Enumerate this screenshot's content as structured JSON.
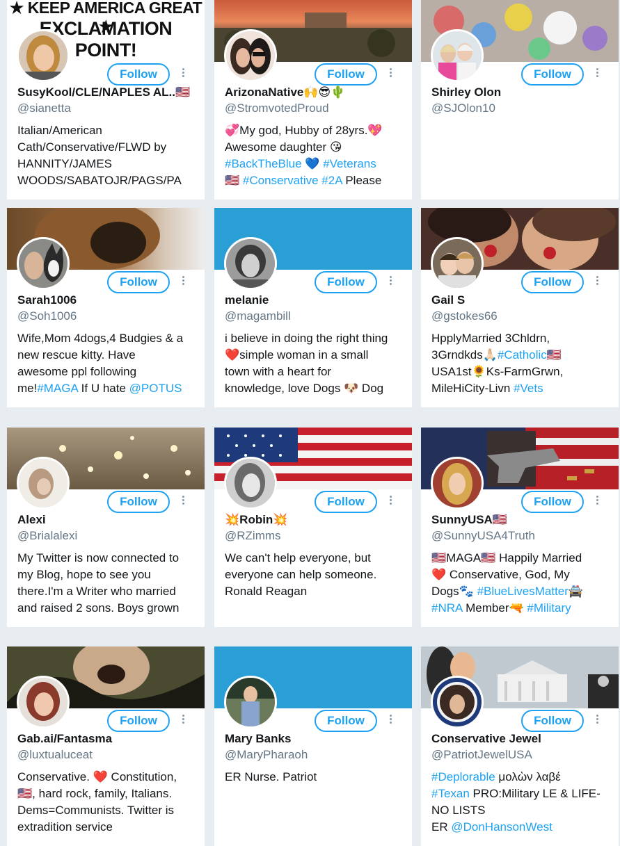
{
  "follow_label": "Follow",
  "cards": [
    {
      "name": "SusyKool/CLE/NAPLES AL..🇺🇸",
      "handle": "@sianetta",
      "banner_text_1": "★ KEEP AMERICA GREAT ★",
      "banner_text_2": "EXCLAMATION POINT!",
      "bio": [
        "Italian/American",
        "Cath/Conservative/FLWD by",
        "HANNITY/JAMES",
        "WOODS/SABATOJR/PAGS/PA"
      ]
    },
    {
      "name": "ArizonaNative🙌😎🌵",
      "handle": "@StromvotedProud",
      "bio_parts": [
        [
          {
            "t": "💞My god, Hubby of 28yrs.💖"
          }
        ],
        [
          {
            "t": "Awesome daughter 😘"
          }
        ],
        [
          {
            "t": "#BackTheBlue",
            "tag": true
          },
          {
            "t": " 💙 "
          },
          {
            "t": "#Veterans",
            "tag": true
          }
        ],
        [
          {
            "t": "🇺🇸 "
          },
          {
            "t": "#Conservative",
            "tag": true
          },
          {
            "t": " "
          },
          {
            "t": "#2A",
            "tag": true
          },
          {
            "t": " Please"
          }
        ]
      ]
    },
    {
      "name": "Shirley Olon",
      "handle": "@SJOlon10",
      "bio": []
    },
    {
      "name": "Sarah1006",
      "handle": "@Soh1006",
      "bio_parts": [
        [
          {
            "t": "Wife,Mom 4dogs,4 Budgies & a"
          }
        ],
        [
          {
            "t": "new rescue kitty. Have"
          }
        ],
        [
          {
            "t": "awesome ppl following"
          }
        ],
        [
          {
            "t": "me!"
          },
          {
            "t": "#MAGA",
            "tag": true
          },
          {
            "t": " If U hate "
          },
          {
            "t": "@POTUS",
            "tag": true
          }
        ]
      ]
    },
    {
      "name": "melanie",
      "handle": "@magambill",
      "bio_parts": [
        [
          {
            "t": "i believe in doing the right thing"
          }
        ],
        [
          {
            "t": "❤️simple woman in a small"
          }
        ],
        [
          {
            "t": "town with a heart for"
          }
        ],
        [
          {
            "t": "knowledge, love Dogs 🐶 Dog"
          }
        ]
      ]
    },
    {
      "name": "Gail S",
      "handle": "@gstokes66",
      "bio_parts": [
        [
          {
            "t": "HpplyMarried 3Chldrn,"
          }
        ],
        [
          {
            "t": "3Grndkds🙏🏻"
          },
          {
            "t": "#Catholic",
            "tag": true
          },
          {
            "t": "🇺🇸"
          }
        ],
        [
          {
            "t": "USA1st🌻Ks-FarmGrwn,"
          }
        ],
        [
          {
            "t": "MileHiCity-Livn "
          },
          {
            "t": "#Vets",
            "tag": true
          }
        ]
      ]
    },
    {
      "name": "Alexi",
      "handle": "@Brialalexi",
      "bio": [
        "My Twitter is now connected to",
        "my Blog, hope to see you",
        "there.I'm a Writer who married",
        "and raised 2 sons. Boys grown"
      ]
    },
    {
      "name": "💥Robin💥",
      "handle": "@RZimms",
      "bio": [
        "We can't help everyone, but",
        "everyone can help someone.",
        "Ronald Reagan"
      ]
    },
    {
      "name": "SunnyUSA🇺🇸",
      "handle": "@SunnyUSA4Truth",
      "bio_parts": [
        [
          {
            "t": "🇺🇸MAGA🇺🇸 Happily Married"
          }
        ],
        [
          {
            "t": "❤️ Conservative, God, My"
          }
        ],
        [
          {
            "t": "Dogs🐾 "
          },
          {
            "t": "#BlueLivesMatter",
            "tag": true
          },
          {
            "t": "🚔"
          }
        ],
        [
          {
            "t": "#NRA",
            "tag": true
          },
          {
            "t": " Member🔫 "
          },
          {
            "t": "#Military",
            "tag": true
          }
        ]
      ]
    },
    {
      "name": "Gab.ai/Fantasma",
      "handle": "@luxtualuceat",
      "bio": [
        "Conservative. ❤️ Constitution,",
        "🇺🇸, hard rock, family, Italians.",
        "Dems=Communists. Twitter is",
        "extradition service"
      ]
    },
    {
      "name": "Mary Banks",
      "handle": "@MaryPharaoh",
      "bio": [
        "ER Nurse. Patriot"
      ]
    },
    {
      "name": "Conservative Jewel",
      "handle": "@PatriotJewelUSA",
      "bio_parts": [
        [
          {
            "t": "#Deplorable",
            "tag": true
          },
          {
            "t": " μολὼν λαβέ"
          }
        ],
        [
          {
            "t": "#Texan",
            "tag": true
          },
          {
            "t": " PRO:Military LE & LIFE-"
          }
        ],
        [
          {
            "t": "NO LISTS"
          }
        ],
        [
          {
            "t": "ER "
          },
          {
            "t": "@DonHansonWest",
            "tag": true
          }
        ]
      ]
    }
  ],
  "colors": {
    "accent": "#1da1f2",
    "background": "#e6ecf0",
    "handle": "#657786"
  }
}
